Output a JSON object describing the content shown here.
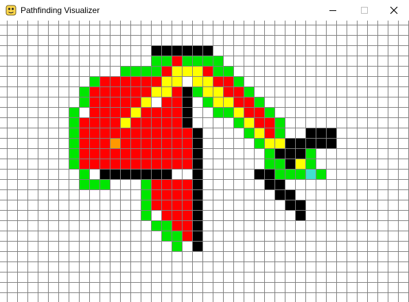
{
  "window": {
    "title": "Pathfinding Visualizer",
    "icon": "python-icon",
    "controls": [
      "minimize-icon",
      "maximize-icon",
      "close-icon"
    ]
  },
  "legend_colors": {
    "empty": "#ffffff",
    "gridline": "#808080",
    "barrier": "#000000",
    "open": "#00e600",
    "closed": "#ff0000",
    "path": "#ffff00",
    "start": "#ff9900",
    "end": "#40e0d0"
  },
  "grid": {
    "columns": 40,
    "rows": 27,
    "barrier": [
      [
        15,
        3
      ],
      [
        16,
        3
      ],
      [
        17,
        3
      ],
      [
        18,
        3
      ],
      [
        19,
        3
      ],
      [
        20,
        3
      ],
      [
        18,
        7
      ],
      [
        18,
        8
      ],
      [
        18,
        9
      ],
      [
        18,
        10
      ],
      [
        19,
        11
      ],
      [
        19,
        12
      ],
      [
        19,
        13
      ],
      [
        19,
        14
      ],
      [
        19,
        15
      ],
      [
        19,
        16
      ],
      [
        19,
        17
      ],
      [
        19,
        18
      ],
      [
        19,
        19
      ],
      [
        19,
        20
      ],
      [
        19,
        21
      ],
      [
        19,
        22
      ],
      [
        10,
        15
      ],
      [
        11,
        15
      ],
      [
        12,
        15
      ],
      [
        13,
        15
      ],
      [
        14,
        15
      ],
      [
        15,
        15
      ],
      [
        16,
        15
      ],
      [
        32,
        11
      ],
      [
        32,
        12
      ],
      [
        31,
        12
      ],
      [
        29,
        12
      ],
      [
        30,
        12
      ],
      [
        28,
        13
      ],
      [
        27,
        13
      ],
      [
        29,
        13
      ],
      [
        28,
        14
      ],
      [
        25,
        15
      ],
      [
        26,
        15
      ],
      [
        26,
        16
      ],
      [
        27,
        16
      ],
      [
        27,
        17
      ],
      [
        28,
        17
      ],
      [
        28,
        18
      ],
      [
        29,
        18
      ],
      [
        29,
        19
      ],
      [
        30,
        12
      ],
      [
        31,
        12
      ],
      [
        32,
        12
      ],
      [
        30,
        11
      ],
      [
        31,
        11
      ],
      [
        28,
        12
      ]
    ],
    "closed": [
      [
        17,
        4
      ],
      [
        16,
        5
      ],
      [
        19,
        5
      ],
      [
        20,
        5
      ],
      [
        10,
        6
      ],
      [
        11,
        6
      ],
      [
        12,
        6
      ],
      [
        13,
        6
      ],
      [
        14,
        6
      ],
      [
        15,
        6
      ],
      [
        17,
        6
      ],
      [
        20,
        6
      ],
      [
        21,
        6
      ],
      [
        22,
        6
      ],
      [
        9,
        7
      ],
      [
        10,
        7
      ],
      [
        11,
        7
      ],
      [
        12,
        7
      ],
      [
        13,
        7
      ],
      [
        14,
        7
      ],
      [
        17,
        7
      ],
      [
        21,
        7
      ],
      [
        22,
        7
      ],
      [
        23,
        7
      ],
      [
        9,
        8
      ],
      [
        10,
        8
      ],
      [
        11,
        8
      ],
      [
        12,
        8
      ],
      [
        13,
        8
      ],
      [
        14,
        8
      ],
      [
        16,
        8
      ],
      [
        17,
        8
      ],
      [
        22,
        8
      ],
      [
        23,
        8
      ],
      [
        24,
        8
      ],
      [
        9,
        9
      ],
      [
        10,
        9
      ],
      [
        11,
        9
      ],
      [
        12,
        9
      ],
      [
        14,
        9
      ],
      [
        15,
        9
      ],
      [
        16,
        9
      ],
      [
        17,
        9
      ],
      [
        23,
        9
      ],
      [
        24,
        9
      ],
      [
        25,
        9
      ],
      [
        8,
        10
      ],
      [
        9,
        10
      ],
      [
        10,
        10
      ],
      [
        11,
        10
      ],
      [
        13,
        10
      ],
      [
        14,
        10
      ],
      [
        15,
        10
      ],
      [
        16,
        10
      ],
      [
        17,
        10
      ],
      [
        24,
        10
      ],
      [
        25,
        10
      ],
      [
        26,
        10
      ],
      [
        8,
        11
      ],
      [
        9,
        11
      ],
      [
        10,
        11
      ],
      [
        11,
        11
      ],
      [
        12,
        11
      ],
      [
        13,
        11
      ],
      [
        14,
        11
      ],
      [
        15,
        11
      ],
      [
        16,
        11
      ],
      [
        17,
        11
      ],
      [
        18,
        11
      ],
      [
        25,
        11
      ],
      [
        26,
        11
      ],
      [
        8,
        12
      ],
      [
        9,
        12
      ],
      [
        10,
        12
      ],
      [
        11,
        12
      ],
      [
        12,
        12
      ],
      [
        13,
        12
      ],
      [
        14,
        12
      ],
      [
        15,
        12
      ],
      [
        16,
        12
      ],
      [
        17,
        12
      ],
      [
        18,
        12
      ],
      [
        26,
        12
      ],
      [
        27,
        12
      ],
      [
        8,
        13
      ],
      [
        9,
        13
      ],
      [
        10,
        13
      ],
      [
        11,
        13
      ],
      [
        12,
        13
      ],
      [
        13,
        13
      ],
      [
        14,
        13
      ],
      [
        15,
        13
      ],
      [
        16,
        13
      ],
      [
        17,
        13
      ],
      [
        18,
        13
      ],
      [
        28,
        13
      ],
      [
        8,
        14
      ],
      [
        9,
        14
      ],
      [
        10,
        14
      ],
      [
        11,
        14
      ],
      [
        12,
        14
      ],
      [
        13,
        14
      ],
      [
        14,
        14
      ],
      [
        15,
        14
      ],
      [
        16,
        14
      ],
      [
        17,
        14
      ],
      [
        18,
        14
      ],
      [
        28,
        14
      ],
      [
        15,
        16
      ],
      [
        16,
        16
      ],
      [
        17,
        16
      ],
      [
        18,
        16
      ],
      [
        15,
        17
      ],
      [
        16,
        17
      ],
      [
        17,
        17
      ],
      [
        18,
        17
      ],
      [
        15,
        18
      ],
      [
        16,
        18
      ],
      [
        17,
        18
      ],
      [
        18,
        18
      ],
      [
        16,
        19
      ],
      [
        17,
        19
      ],
      [
        18,
        19
      ],
      [
        17,
        20
      ],
      [
        18,
        20
      ],
      [
        18,
        21
      ]
    ],
    "open": [
      [
        17,
        3
      ],
      [
        18,
        3
      ],
      [
        15,
        4
      ],
      [
        16,
        4
      ],
      [
        18,
        4
      ],
      [
        19,
        4
      ],
      [
        20,
        4
      ],
      [
        21,
        4
      ],
      [
        12,
        5
      ],
      [
        13,
        5
      ],
      [
        14,
        5
      ],
      [
        15,
        5
      ],
      [
        21,
        5
      ],
      [
        22,
        5
      ],
      [
        9,
        6
      ],
      [
        19,
        6
      ],
      [
        22,
        6
      ],
      [
        23,
        6
      ],
      [
        8,
        7
      ],
      [
        19,
        7
      ],
      [
        20,
        7
      ],
      [
        24,
        7
      ],
      [
        8,
        8
      ],
      [
        20,
        8
      ],
      [
        25,
        8
      ],
      [
        7,
        9
      ],
      [
        21,
        9
      ],
      [
        22,
        9
      ],
      [
        26,
        9
      ],
      [
        7,
        10
      ],
      [
        23,
        10
      ],
      [
        27,
        10
      ],
      [
        7,
        11
      ],
      [
        24,
        11
      ],
      [
        27,
        11
      ],
      [
        7,
        12
      ],
      [
        25,
        12
      ],
      [
        7,
        13
      ],
      [
        26,
        13
      ],
      [
        27,
        13
      ],
      [
        30,
        13
      ],
      [
        7,
        14
      ],
      [
        26,
        14
      ],
      [
        27,
        14
      ],
      [
        29,
        14
      ],
      [
        30,
        14
      ],
      [
        8,
        15
      ],
      [
        27,
        15
      ],
      [
        28,
        15
      ],
      [
        29,
        15
      ],
      [
        30,
        15
      ],
      [
        31,
        15
      ],
      [
        8,
        16
      ],
      [
        9,
        16
      ],
      [
        10,
        16
      ],
      [
        14,
        16
      ],
      [
        14,
        17
      ],
      [
        14,
        18
      ],
      [
        14,
        19
      ],
      [
        15,
        20
      ],
      [
        16,
        20
      ],
      [
        16,
        21
      ],
      [
        17,
        21
      ],
      [
        17,
        22
      ]
    ],
    "path": [
      [
        17,
        5
      ],
      [
        18,
        5
      ],
      [
        19,
        5
      ],
      [
        16,
        6
      ],
      [
        17,
        6
      ],
      [
        19,
        6
      ],
      [
        20,
        6
      ],
      [
        15,
        7
      ],
      [
        16,
        7
      ],
      [
        20,
        7
      ],
      [
        21,
        7
      ],
      [
        14,
        8
      ],
      [
        21,
        8
      ],
      [
        22,
        8
      ],
      [
        13,
        9
      ],
      [
        23,
        9
      ],
      [
        12,
        10
      ],
      [
        24,
        10
      ],
      [
        25,
        11
      ],
      [
        26,
        12
      ],
      [
        27,
        12
      ],
      [
        27,
        13
      ],
      [
        28,
        13
      ],
      [
        28,
        14
      ],
      [
        29,
        14
      ]
    ],
    "start": [
      11,
      12
    ],
    "end": [
      30,
      15
    ]
  }
}
